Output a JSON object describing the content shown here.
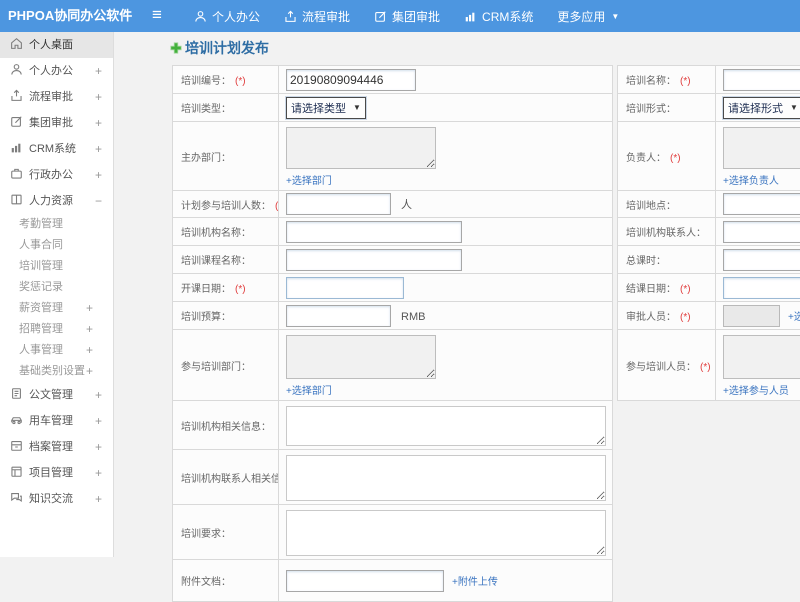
{
  "colors": {
    "header_bg": "#4d96e0",
    "title_text": "#2e6da4",
    "link_blue": "#3a74c0",
    "required_red": "#e03b3b",
    "plus_green": "#43b13c"
  },
  "header": {
    "logo": "PHPOA协同办公软件",
    "menu_icon": "hamburger-icon",
    "nav": [
      {
        "id": "personal-office",
        "label": "个人办公",
        "icon": "user-icon"
      },
      {
        "id": "workflow-approval",
        "label": "流程审批",
        "icon": "upload-icon"
      },
      {
        "id": "group-approval",
        "label": "集团审批",
        "icon": "edit-icon"
      },
      {
        "id": "crm-system",
        "label": "CRM系统",
        "icon": "chart-icon"
      },
      {
        "id": "more-apps",
        "label": "更多应用",
        "caret": true
      }
    ]
  },
  "sidebar": {
    "items": [
      {
        "id": "personal-desktop",
        "label": "个人桌面",
        "icon": "home-icon",
        "active": true
      },
      {
        "id": "personal-office",
        "label": "个人办公",
        "icon": "user-icon",
        "expand": "+"
      },
      {
        "id": "workflow-approval",
        "label": "流程审批",
        "icon": "upload-icon",
        "expand": "+"
      },
      {
        "id": "group-approval",
        "label": "集团审批",
        "icon": "edit-icon",
        "expand": "+"
      },
      {
        "id": "crm-system",
        "label": "CRM系统",
        "icon": "chart-icon",
        "expand": "+"
      },
      {
        "id": "admin-office",
        "label": "行政办公",
        "icon": "briefcase-icon",
        "expand": "+"
      },
      {
        "id": "human-resources",
        "label": "人力资源",
        "icon": "book-icon",
        "expand": "−"
      },
      {
        "id": "attendance-mgmt",
        "label": "考勤管理",
        "sub": true
      },
      {
        "id": "hr-contract",
        "label": "人事合同",
        "sub": true
      },
      {
        "id": "training-mgmt",
        "label": "培训管理",
        "sub": true
      },
      {
        "id": "reward-records",
        "label": "奖惩记录",
        "sub": true
      },
      {
        "id": "salary-mgmt",
        "label": "薪资管理",
        "sub": true,
        "expand": "+"
      },
      {
        "id": "recruit-mgmt",
        "label": "招聘管理",
        "sub": true,
        "expand": "+"
      },
      {
        "id": "personnel-mgmt",
        "label": "人事管理",
        "sub": true,
        "expand": "+"
      },
      {
        "id": "base-category-settings",
        "label": "基础类别设置",
        "sub": true,
        "expand": "+"
      },
      {
        "id": "document-mgmt",
        "label": "公文管理",
        "icon": "doc-icon",
        "expand": "+"
      },
      {
        "id": "vehicle-mgmt",
        "label": "用车管理",
        "icon": "car-icon",
        "expand": "+"
      },
      {
        "id": "archive-mgmt",
        "label": "档案管理",
        "icon": "archive-icon",
        "expand": "+"
      },
      {
        "id": "project-mgmt",
        "label": "项目管理",
        "icon": "project-icon",
        "expand": "+"
      },
      {
        "id": "knowledge-exchange",
        "label": "知识交流",
        "icon": "chat-icon",
        "expand": "+"
      }
    ]
  },
  "main": {
    "title": "培训计划发布",
    "title_icon": "plus-icon"
  },
  "form_left": {
    "no": {
      "label": "培训编号：",
      "required": "(*)",
      "value": "20190809094446"
    },
    "type": {
      "label": "培训类型：",
      "select": "请选择类型"
    },
    "host_dept": {
      "label": "主办部门：",
      "link": "+选择部门"
    },
    "planned_count": {
      "label": "计划参与培训人数：",
      "required": "(*)",
      "suffix": "人"
    },
    "org_name": {
      "label": "培训机构名称："
    },
    "course_name": {
      "label": "培训课程名称："
    },
    "start_date": {
      "label": "开课日期：",
      "required": "(*)"
    },
    "budget": {
      "label": "培训预算：",
      "suffix": "RMB"
    },
    "join_dept": {
      "label": "参与培训部门：",
      "link": "+选择部门"
    },
    "org_info": {
      "label": "培训机构相关信息："
    },
    "org_contact_info": {
      "label": "培训机构联系人相关信息："
    },
    "requirement": {
      "label": "培训要求："
    },
    "attachment": {
      "label": "附件文档：",
      "link": "+附件上传"
    }
  },
  "form_right": {
    "name": {
      "label": "培训名称：",
      "required": "(*)"
    },
    "mode": {
      "label": "培训形式：",
      "select": "请选择形式"
    },
    "leader": {
      "label": "负责人：",
      "required": "(*)",
      "link": "+选择负责人"
    },
    "place": {
      "label": "培训地点："
    },
    "org_contact": {
      "label": "培训机构联系人："
    },
    "total_hours": {
      "label": "总课时："
    },
    "end_date": {
      "label": "结课日期：",
      "required": "(*)"
    },
    "approver": {
      "label": "审批人员：",
      "required": "(*)",
      "link": "+选择审批人员"
    },
    "participants": {
      "label": "参与培训人员：",
      "required": "(*)",
      "link": "+选择参与人员"
    }
  }
}
